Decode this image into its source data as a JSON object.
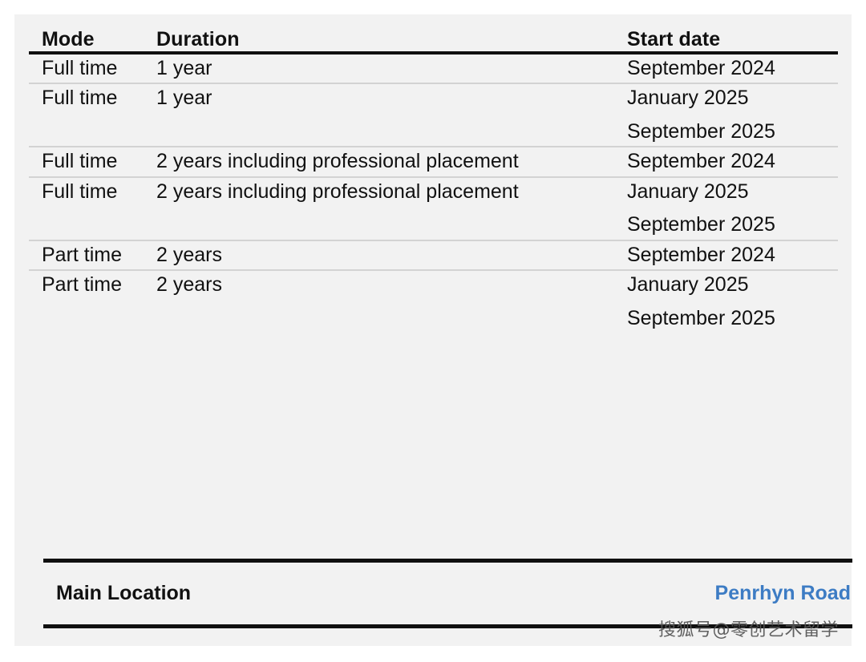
{
  "panel": {
    "background_color": "#f2f2f2",
    "page_background_color": "#ffffff"
  },
  "table": {
    "columns": [
      "Mode",
      "Duration",
      "Start date"
    ],
    "rows": [
      {
        "mode": "Full time",
        "duration": "1 year",
        "start_dates": [
          "September 2024"
        ]
      },
      {
        "mode": "Full time",
        "duration": "1 year",
        "start_dates": [
          "January 2025",
          "September 2025"
        ]
      },
      {
        "mode": "Full time",
        "duration": "2 years including professional placement",
        "start_dates": [
          "September 2024"
        ]
      },
      {
        "mode": "Full time",
        "duration": "2 years including professional placement",
        "start_dates": [
          "January 2025",
          "September 2025"
        ]
      },
      {
        "mode": "Part time",
        "duration": "2 years",
        "start_dates": [
          "September 2024"
        ]
      },
      {
        "mode": "Part time",
        "duration": "2 years",
        "start_dates": [
          "January 2025",
          "September 2025"
        ]
      }
    ]
  },
  "location": {
    "label": "Main Location",
    "link_text": "Penrhyn Road",
    "link_color": "#3d7cc4"
  },
  "watermark": {
    "text": "搜狐号@零创艺术留学"
  }
}
